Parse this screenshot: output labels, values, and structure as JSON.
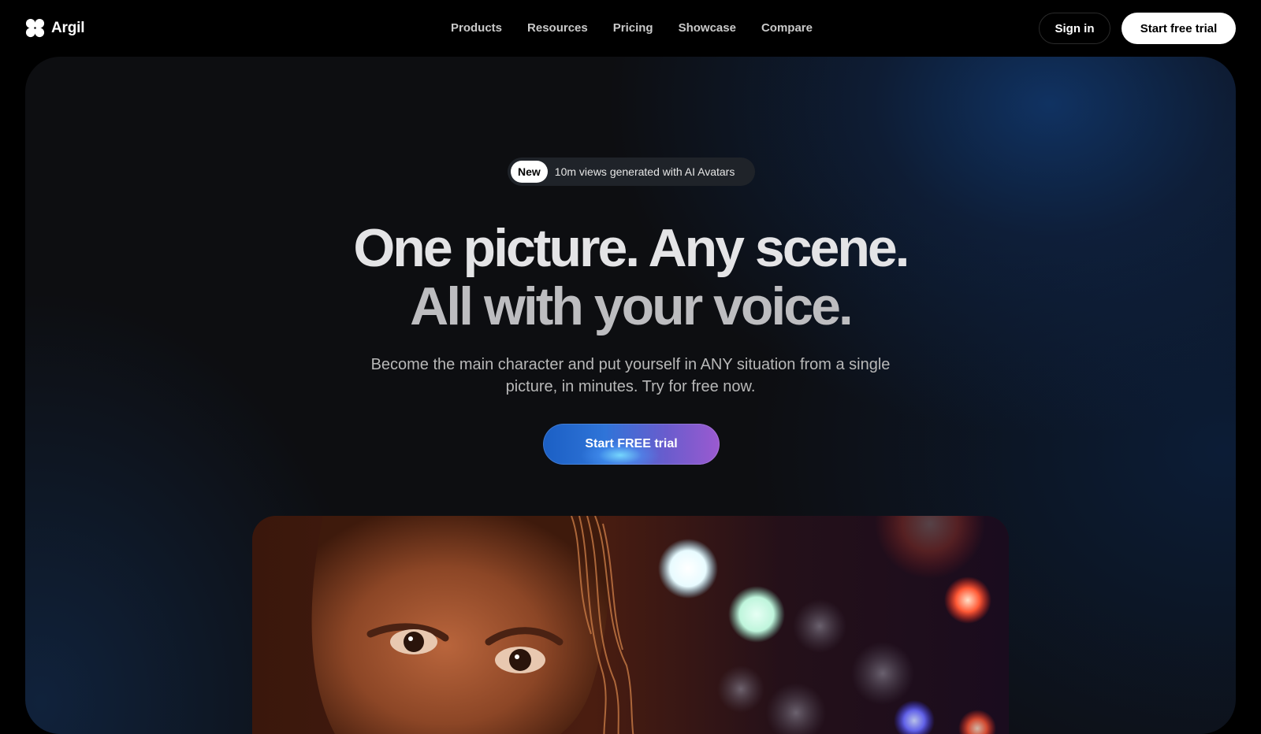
{
  "brand": {
    "name": "Argil"
  },
  "nav": {
    "links": [
      "Products",
      "Resources",
      "Pricing",
      "Showcase",
      "Compare"
    ]
  },
  "header": {
    "signin_label": "Sign in",
    "trial_label": "Start free trial"
  },
  "hero": {
    "badge_tag": "New",
    "badge_text": "10m views generated with AI Avatars",
    "headline_line1": "One picture. Any scene.",
    "headline_line2": "All with your voice.",
    "subtitle": "Become the main character and put yourself in ANY situation from a single picture, in minutes. Try for free now.",
    "cta_label": "Start FREE trial"
  },
  "colors": {
    "background": "#000000",
    "hero_accent": "#0e2f5c",
    "cta_start": "#1b5fc4",
    "cta_end": "#9b5ad0"
  },
  "icons": {
    "brand": "four-petal-logo-icon"
  }
}
